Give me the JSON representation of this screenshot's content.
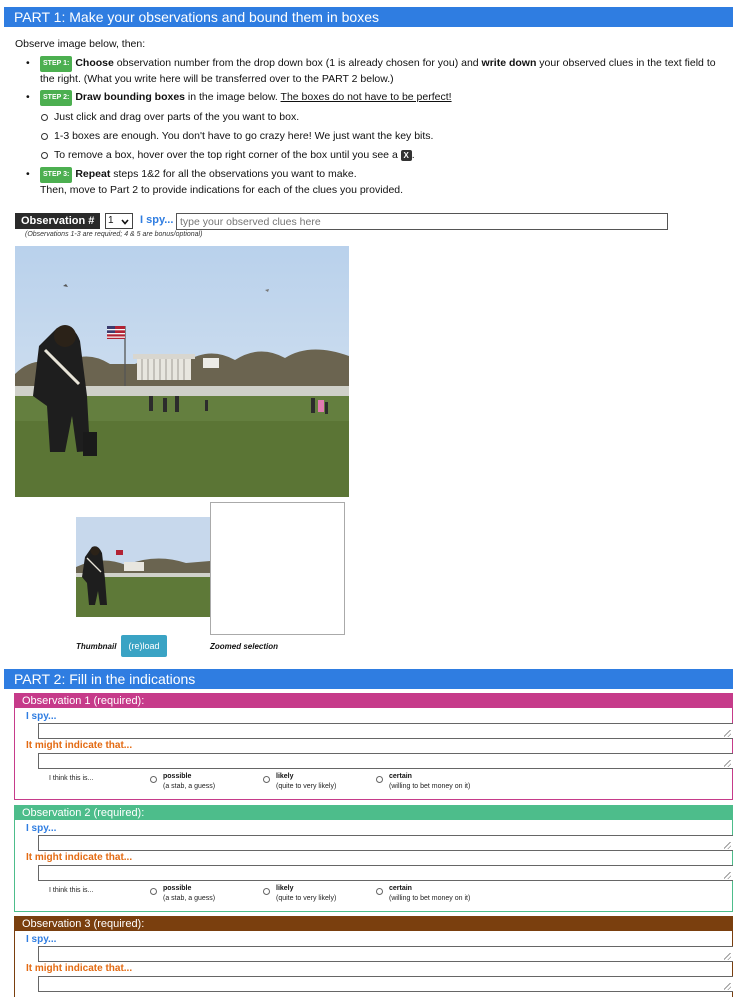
{
  "part1": {
    "title": "PART 1: Make your observations and bound them in boxes"
  },
  "intro": "Observe image below, then:",
  "step1": {
    "badge": "STEP 1:",
    "bold1": "Choose",
    "text1": " observation number from the drop down box (1 is already chosen for you) and ",
    "bold2": "write down",
    "text2": " your observed clues in the text field to the right. (What you write here will be transferred over to the PART 2 below.)"
  },
  "step2": {
    "badge": "STEP 2:",
    "bold": "Draw bounding boxes",
    "text": " in the image below. ",
    "underline": "The boxes do not have to be perfect!",
    "subs": [
      "Just click and drag over parts of the you want to box.",
      "1-3 boxes are enough. You don't have to go crazy here! We just want the key bits.",
      "To remove a box, hover over the top right corner of the box until you see a"
    ],
    "x_glyph": "X"
  },
  "step3": {
    "badge": "STEP 3:",
    "bold": "Repeat",
    "text": " steps 1&2 for all the observations you want to make.",
    "line2": "Then, move to Part 2 to provide indications for each of the clues you provided."
  },
  "observation": {
    "label": "Observation #",
    "selected": "1",
    "ispy": "I spy...",
    "placeholder": "type your observed clues here",
    "note": "(Observations 1-3 are required; 4 & 5 are bonus/optional)"
  },
  "thumb": {
    "label": "Thumbnail",
    "reload": "(re)load",
    "zoom_label": "Zoomed selection"
  },
  "part2": {
    "title": "PART 2: Fill in the indications"
  },
  "obs_cards": [
    {
      "title": "Observation 1 (required):",
      "color": "#c63b8a"
    },
    {
      "title": "Observation 2 (required):",
      "color": "#4dbd8b"
    },
    {
      "title": "Observation 3 (required):",
      "color": "#7a3f0e"
    }
  ],
  "card_labels": {
    "ispy": "I spy...",
    "indicate": "It might indicate that...",
    "think": "I think this is..."
  },
  "confidence": [
    {
      "title": "possible",
      "sub": "(a stab, a guess)"
    },
    {
      "title": "likely",
      "sub": "(quite to very likely)"
    },
    {
      "title": "certain",
      "sub": "(willing to bet money on it)"
    }
  ],
  "colors": {
    "accent_blue": "#2f7de1",
    "indicate_orange": "#e36a12",
    "step_green": "#4caf50",
    "reload_teal": "#3aa3c4"
  }
}
